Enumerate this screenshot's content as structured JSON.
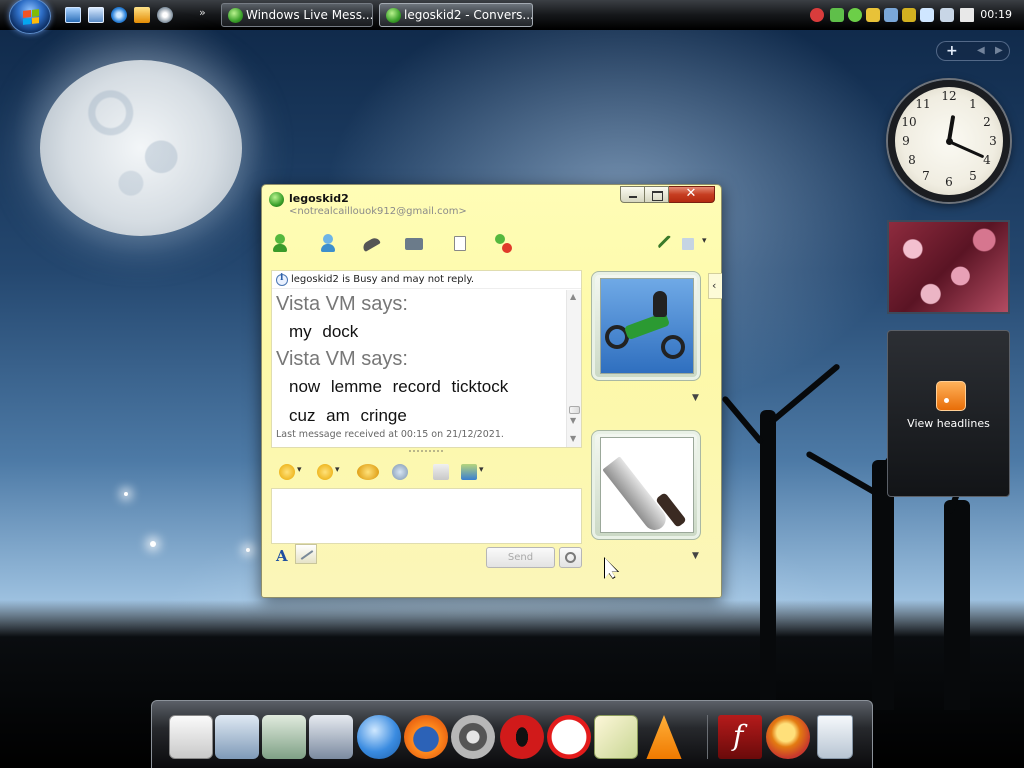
{
  "taskbar": {
    "tasks": [
      {
        "label": "Windows Live Mess...",
        "active": false
      },
      {
        "label": "legoskid2 - Convers...",
        "active": true
      }
    ],
    "clock": "00:19"
  },
  "conversation": {
    "contact_name": "legoskid2",
    "contact_email": "<notrealcaillouok912@gmail.com>",
    "status_notice": "legoskid2 is Busy and may not reply.",
    "messages": [
      {
        "sender": "Vista VM says:",
        "lines": [
          "my dock"
        ]
      },
      {
        "sender": "Vista VM says:",
        "lines": [
          "now lemme record ticktock",
          "cuz am cringe"
        ]
      }
    ],
    "last_received": "Last message received at 00:15 on 21/12/2021.",
    "input_value": "",
    "send_label": "Send",
    "close_glyph": "✕"
  },
  "gadgets": {
    "feed_label": "View headlines",
    "clock_hour": 12,
    "clock_minute": 19
  },
  "colors": {
    "window_bg": "#fdf9a8",
    "accent_green": "#3aa02a"
  }
}
